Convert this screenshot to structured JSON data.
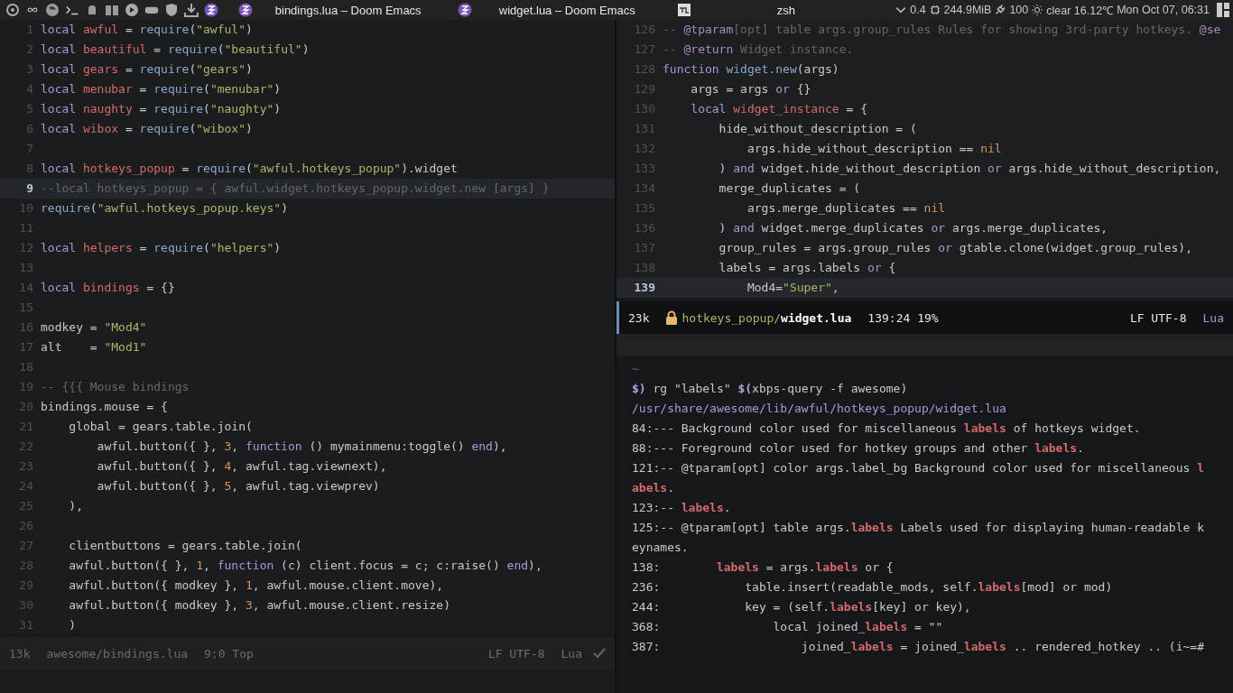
{
  "top_bar": {
    "tasks": [
      {
        "kind": "emacs",
        "title": "bindings.lua – Doom Emacs"
      },
      {
        "kind": "emacs",
        "title": "widget.lua – Doom Emacs"
      },
      {
        "kind": "terminal",
        "title": "zsh"
      }
    ],
    "status": {
      "load": "0.4",
      "memory": "244.9MiB",
      "battery": "100",
      "weather": "clear 16.12℃",
      "clock": "Mon Oct 07, 06:31"
    }
  },
  "left_editor": {
    "lines": [
      {
        "number": "1",
        "current": false,
        "tokens": [
          {
            "kind": "keyword",
            "text": "local "
          },
          {
            "kind": "variable",
            "text": "awful"
          },
          {
            "kind": "plain",
            "text": " = "
          },
          {
            "kind": "function",
            "text": "require"
          },
          {
            "kind": "plain",
            "text": "("
          },
          {
            "kind": "string",
            "text": "\"awful\""
          },
          {
            "kind": "plain",
            "text": ")"
          }
        ]
      },
      {
        "number": "2",
        "current": false,
        "tokens": [
          {
            "kind": "keyword",
            "text": "local "
          },
          {
            "kind": "variable",
            "text": "beautiful"
          },
          {
            "kind": "plain",
            "text": " = "
          },
          {
            "kind": "function",
            "text": "require"
          },
          {
            "kind": "plain",
            "text": "("
          },
          {
            "kind": "string",
            "text": "\"beautiful\""
          },
          {
            "kind": "plain",
            "text": ")"
          }
        ]
      },
      {
        "number": "3",
        "current": false,
        "tokens": [
          {
            "kind": "keyword",
            "text": "local "
          },
          {
            "kind": "variable",
            "text": "gears"
          },
          {
            "kind": "plain",
            "text": " = "
          },
          {
            "kind": "function",
            "text": "require"
          },
          {
            "kind": "plain",
            "text": "("
          },
          {
            "kind": "string",
            "text": "\"gears\""
          },
          {
            "kind": "plain",
            "text": ")"
          }
        ]
      },
      {
        "number": "4",
        "current": false,
        "tokens": [
          {
            "kind": "keyword",
            "text": "local "
          },
          {
            "kind": "variable",
            "text": "menubar"
          },
          {
            "kind": "plain",
            "text": " = "
          },
          {
            "kind": "function",
            "text": "require"
          },
          {
            "kind": "plain",
            "text": "("
          },
          {
            "kind": "string",
            "text": "\"menubar\""
          },
          {
            "kind": "plain",
            "text": ")"
          }
        ]
      },
      {
        "number": "5",
        "current": false,
        "tokens": [
          {
            "kind": "keyword",
            "text": "local "
          },
          {
            "kind": "variable",
            "text": "naughty"
          },
          {
            "kind": "plain",
            "text": " = "
          },
          {
            "kind": "function",
            "text": "require"
          },
          {
            "kind": "plain",
            "text": "("
          },
          {
            "kind": "string",
            "text": "\"naughty\""
          },
          {
            "kind": "plain",
            "text": ")"
          }
        ]
      },
      {
        "number": "6",
        "current": false,
        "tokens": [
          {
            "kind": "keyword",
            "text": "local "
          },
          {
            "kind": "variable",
            "text": "wibox"
          },
          {
            "kind": "plain",
            "text": " = "
          },
          {
            "kind": "function",
            "text": "require"
          },
          {
            "kind": "plain",
            "text": "("
          },
          {
            "kind": "string",
            "text": "\"wibox\""
          },
          {
            "kind": "plain",
            "text": ")"
          }
        ]
      },
      {
        "number": "7",
        "current": false
      },
      {
        "number": "8",
        "current": false,
        "tokens": [
          {
            "kind": "keyword",
            "text": "local "
          },
          {
            "kind": "variable",
            "text": "hotkeys_popup"
          },
          {
            "kind": "plain",
            "text": " = "
          },
          {
            "kind": "function",
            "text": "require"
          },
          {
            "kind": "plain",
            "text": "("
          },
          {
            "kind": "string",
            "text": "\"awful.hotkeys_popup\""
          },
          {
            "kind": "plain",
            "text": ").widget"
          }
        ]
      },
      {
        "number": "9",
        "current": true,
        "tokens": [
          {
            "kind": "comment",
            "text": "--local hotkeys_popup = { awful.widget.hotkeys_popup.widget.new [args] }"
          }
        ]
      },
      {
        "number": "10",
        "current": false,
        "tokens": [
          {
            "kind": "function",
            "text": "require"
          },
          {
            "kind": "plain",
            "text": "("
          },
          {
            "kind": "string",
            "text": "\"awful.hotkeys_popup.keys\""
          },
          {
            "kind": "plain",
            "text": ")"
          }
        ]
      },
      {
        "number": "11",
        "current": false
      },
      {
        "number": "12",
        "current": false,
        "tokens": [
          {
            "kind": "keyword",
            "text": "local "
          },
          {
            "kind": "variable",
            "text": "helpers"
          },
          {
            "kind": "plain",
            "text": " = "
          },
          {
            "kind": "function",
            "text": "require"
          },
          {
            "kind": "plain",
            "text": "("
          },
          {
            "kind": "string",
            "text": "\"helpers\""
          },
          {
            "kind": "plain",
            "text": ")"
          }
        ]
      },
      {
        "number": "13",
        "current": false
      },
      {
        "number": "14",
        "current": false,
        "tokens": [
          {
            "kind": "keyword",
            "text": "local "
          },
          {
            "kind": "variable",
            "text": "bindings"
          },
          {
            "kind": "plain",
            "text": " = {}"
          }
        ]
      },
      {
        "number": "15",
        "current": false
      },
      {
        "number": "16",
        "current": false,
        "tokens": [
          {
            "kind": "plain",
            "text": "modkey = "
          },
          {
            "kind": "string",
            "text": "\"Mod4\""
          }
        ]
      },
      {
        "number": "17",
        "current": false,
        "tokens": [
          {
            "kind": "plain",
            "text": "alt    = "
          },
          {
            "kind": "string",
            "text": "\"Mod1\""
          }
        ]
      },
      {
        "number": "18",
        "current": false
      },
      {
        "number": "19",
        "current": false,
        "tokens": [
          {
            "kind": "comment",
            "text": "-- {{{ Mouse bindings"
          }
        ]
      },
      {
        "number": "20",
        "current": false,
        "tokens": [
          {
            "kind": "plain",
            "text": "bindings.mouse = {"
          }
        ]
      },
      {
        "number": "21",
        "current": false,
        "tokens": [
          {
            "kind": "plain",
            "text": "    global = gears.table.join("
          }
        ]
      },
      {
        "number": "22",
        "current": false,
        "tokens": [
          {
            "kind": "plain",
            "text": "        awful.button({ }, "
          },
          {
            "kind": "number",
            "text": "3"
          },
          {
            "kind": "plain",
            "text": ", "
          },
          {
            "kind": "keyword",
            "text": "function"
          },
          {
            "kind": "plain",
            "text": " () mymainmenu:toggle() "
          },
          {
            "kind": "keyword",
            "text": "end"
          },
          {
            "kind": "plain",
            "text": "),"
          }
        ]
      },
      {
        "number": "23",
        "current": false,
        "tokens": [
          {
            "kind": "plain",
            "text": "        awful.button({ }, "
          },
          {
            "kind": "number",
            "text": "4"
          },
          {
            "kind": "plain",
            "text": ", awful.tag.viewnext),"
          }
        ]
      },
      {
        "number": "24",
        "current": false,
        "tokens": [
          {
            "kind": "plain",
            "text": "        awful.button({ }, "
          },
          {
            "kind": "number",
            "text": "5"
          },
          {
            "kind": "plain",
            "text": ", awful.tag.viewprev)"
          }
        ]
      },
      {
        "number": "25",
        "current": false,
        "tokens": [
          {
            "kind": "plain",
            "text": "    ),"
          }
        ]
      },
      {
        "number": "26",
        "current": false
      },
      {
        "number": "27",
        "current": false,
        "tokens": [
          {
            "kind": "plain",
            "text": "    clientbuttons = gears.table.join("
          }
        ]
      },
      {
        "number": "28",
        "current": false,
        "tokens": [
          {
            "kind": "plain",
            "text": "    awful.button({ }, "
          },
          {
            "kind": "number",
            "text": "1"
          },
          {
            "kind": "plain",
            "text": ", "
          },
          {
            "kind": "keyword",
            "text": "function"
          },
          {
            "kind": "plain",
            "text": " (c) client.focus = c; c:raise() "
          },
          {
            "kind": "keyword",
            "text": "end"
          },
          {
            "kind": "plain",
            "text": "),"
          }
        ]
      },
      {
        "number": "29",
        "current": false,
        "tokens": [
          {
            "kind": "plain",
            "text": "    awful.button({ modkey }, "
          },
          {
            "kind": "number",
            "text": "1"
          },
          {
            "kind": "plain",
            "text": ", awful.mouse.client.move),"
          }
        ]
      },
      {
        "number": "30",
        "current": false,
        "tokens": [
          {
            "kind": "plain",
            "text": "    awful.button({ modkey }, "
          },
          {
            "kind": "number",
            "text": "3"
          },
          {
            "kind": "plain",
            "text": ", awful.mouse.client.resize)"
          }
        ]
      },
      {
        "number": "31",
        "current": false,
        "tokens": [
          {
            "kind": "plain",
            "text": "    )"
          }
        ]
      }
    ],
    "mode_line": {
      "active": false,
      "size": "13k",
      "directory": "awesome/",
      "file": "bindings.lua",
      "position": "9:0 Top",
      "encoding": "LF UTF-8",
      "mode": "Lua"
    }
  },
  "right_editor": {
    "lines": [
      {
        "number": "126",
        "current": false,
        "tokens": [
          {
            "kind": "comment",
            "text": "-- "
          },
          {
            "kind": "doc-tag",
            "text": "@tparam"
          },
          {
            "kind": "comment",
            "text": "[opt] table args.group_rules Rules for showing 3rd-party hotkeys. "
          },
          {
            "kind": "doc-tag",
            "text": "@se"
          }
        ]
      },
      {
        "number": "127",
        "current": false,
        "tokens": [
          {
            "kind": "comment",
            "text": "-- "
          },
          {
            "kind": "doc-tag",
            "text": "@return"
          },
          {
            "kind": "comment",
            "text": " Widget instance."
          }
        ]
      },
      {
        "number": "128",
        "current": false,
        "tokens": [
          {
            "kind": "keyword",
            "text": "function "
          },
          {
            "kind": "function",
            "text": "widget.new"
          },
          {
            "kind": "plain",
            "text": "(args)"
          }
        ]
      },
      {
        "number": "129",
        "current": false,
        "tokens": [
          {
            "kind": "plain",
            "text": "    args = args "
          },
          {
            "kind": "keyword",
            "text": "or"
          },
          {
            "kind": "plain",
            "text": " {}"
          }
        ]
      },
      {
        "number": "130",
        "current": false,
        "tokens": [
          {
            "kind": "keyword",
            "text": "    local "
          },
          {
            "kind": "variable",
            "text": "widget_instance"
          },
          {
            "kind": "plain",
            "text": " = {"
          }
        ]
      },
      {
        "number": "131",
        "current": false,
        "tokens": [
          {
            "kind": "plain",
            "text": "        hide_without_description = ("
          }
        ]
      },
      {
        "number": "132",
        "current": false,
        "tokens": [
          {
            "kind": "plain",
            "text": "            args.hide_without_description == "
          },
          {
            "kind": "number",
            "text": "nil"
          }
        ]
      },
      {
        "number": "133",
        "current": false,
        "tokens": [
          {
            "kind": "plain",
            "text": "        ) "
          },
          {
            "kind": "keyword",
            "text": "and"
          },
          {
            "kind": "plain",
            "text": " widget.hide_without_description "
          },
          {
            "kind": "keyword",
            "text": "or"
          },
          {
            "kind": "plain",
            "text": " args.hide_without_description,"
          }
        ]
      },
      {
        "number": "134",
        "current": false,
        "tokens": [
          {
            "kind": "plain",
            "text": "        merge_duplicates = ("
          }
        ]
      },
      {
        "number": "135",
        "current": false,
        "tokens": [
          {
            "kind": "plain",
            "text": "            args.merge_duplicates == "
          },
          {
            "kind": "number",
            "text": "nil"
          }
        ]
      },
      {
        "number": "136",
        "current": false,
        "tokens": [
          {
            "kind": "plain",
            "text": "        ) "
          },
          {
            "kind": "keyword",
            "text": "and"
          },
          {
            "kind": "plain",
            "text": " widget.merge_duplicates "
          },
          {
            "kind": "keyword",
            "text": "or"
          },
          {
            "kind": "plain",
            "text": " args.merge_duplicates,"
          }
        ]
      },
      {
        "number": "137",
        "current": false,
        "tokens": [
          {
            "kind": "plain",
            "text": "        group_rules = args.group_rules "
          },
          {
            "kind": "keyword",
            "text": "or"
          },
          {
            "kind": "plain",
            "text": " gtable.clone(widget.group_rules),"
          }
        ]
      },
      {
        "number": "138",
        "current": false,
        "tokens": [
          {
            "kind": "plain",
            "text": "        labels = args.labels "
          },
          {
            "kind": "keyword",
            "text": "or"
          },
          {
            "kind": "plain",
            "text": " {"
          }
        ]
      },
      {
        "number": "139",
        "current": true,
        "tokens": [
          {
            "kind": "plain",
            "text": "            Mod4="
          },
          {
            "kind": "string",
            "text": "\"Super\""
          },
          {
            "kind": "plain",
            "text": ","
          }
        ]
      }
    ],
    "mode_line": {
      "active": true,
      "size": "23k",
      "directory": "hotkeys_popup/",
      "file": "widget.lua",
      "position": "139:24 19%",
      "encoding": "LF UTF-8",
      "mode": "Lua"
    }
  },
  "terminal": {
    "lines": [
      {
        "tokens": [
          {
            "kind": "comment",
            "text": "~"
          }
        ]
      },
      {
        "tokens": [
          {
            "kind": "prompt",
            "text": "$)"
          },
          {
            "kind": "plain",
            "text": " rg \"labels\" "
          },
          {
            "kind": "prompt",
            "text": "$("
          },
          {
            "kind": "plain",
            "text": "xbps-query -f awesome)"
          }
        ]
      },
      {
        "tokens": [
          {
            "kind": "path",
            "text": "/usr/share/awesome/lib/awful/hotkeys_popup/widget.lua"
          }
        ]
      },
      {
        "tokens": [
          {
            "kind": "plain",
            "text": "84:--- Background color used for miscellaneous "
          },
          {
            "kind": "match",
            "text": "labels"
          },
          {
            "kind": "plain",
            "text": " of hotkeys widget."
          }
        ]
      },
      {
        "tokens": [
          {
            "kind": "plain",
            "text": "88:--- Foreground color used for hotkey groups and other "
          },
          {
            "kind": "match",
            "text": "labels"
          },
          {
            "kind": "plain",
            "text": "."
          }
        ]
      },
      {
        "tokens": [
          {
            "kind": "plain",
            "text": "121:-- @tparam[opt] color args.label_bg Background color used for miscellaneous "
          },
          {
            "kind": "match",
            "text": "l"
          }
        ]
      },
      {
        "tokens": [
          {
            "kind": "match",
            "text": "abels"
          },
          {
            "kind": "plain",
            "text": "."
          }
        ]
      },
      {
        "tokens": [
          {
            "kind": "plain",
            "text": "123:-- "
          },
          {
            "kind": "match",
            "text": "labels"
          },
          {
            "kind": "plain",
            "text": "."
          }
        ]
      },
      {
        "tokens": [
          {
            "kind": "plain",
            "text": "125:-- @tparam[opt] table args."
          },
          {
            "kind": "match",
            "text": "labels"
          },
          {
            "kind": "plain",
            "text": " Labels used for displaying human-readable k"
          }
        ]
      },
      {
        "tokens": [
          {
            "kind": "plain",
            "text": "eynames."
          }
        ]
      },
      {
        "tokens": [
          {
            "kind": "plain",
            "text": "138:        "
          },
          {
            "kind": "match",
            "text": "labels"
          },
          {
            "kind": "plain",
            "text": " = args."
          },
          {
            "kind": "match",
            "text": "labels"
          },
          {
            "kind": "plain",
            "text": " or {"
          }
        ]
      },
      {
        "tokens": [
          {
            "kind": "plain",
            "text": "236:            table.insert(readable_mods, self."
          },
          {
            "kind": "match",
            "text": "labels"
          },
          {
            "kind": "plain",
            "text": "[mod] or mod)"
          }
        ]
      },
      {
        "tokens": [
          {
            "kind": "plain",
            "text": "244:            key = (self."
          },
          {
            "kind": "match",
            "text": "labels"
          },
          {
            "kind": "plain",
            "text": "[key] or key),"
          }
        ]
      },
      {
        "tokens": [
          {
            "kind": "plain",
            "text": "368:                local joined_"
          },
          {
            "kind": "match",
            "text": "labels"
          },
          {
            "kind": "plain",
            "text": " = \"\""
          }
        ]
      },
      {
        "tokens": [
          {
            "kind": "plain",
            "text": "387:                    joined_"
          },
          {
            "kind": "match",
            "text": "labels"
          },
          {
            "kind": "plain",
            "text": " = joined_"
          },
          {
            "kind": "match",
            "text": "labels"
          },
          {
            "kind": "plain",
            "text": " .. rendered_hotkey .. (i~=#"
          }
        ]
      }
    ]
  }
}
